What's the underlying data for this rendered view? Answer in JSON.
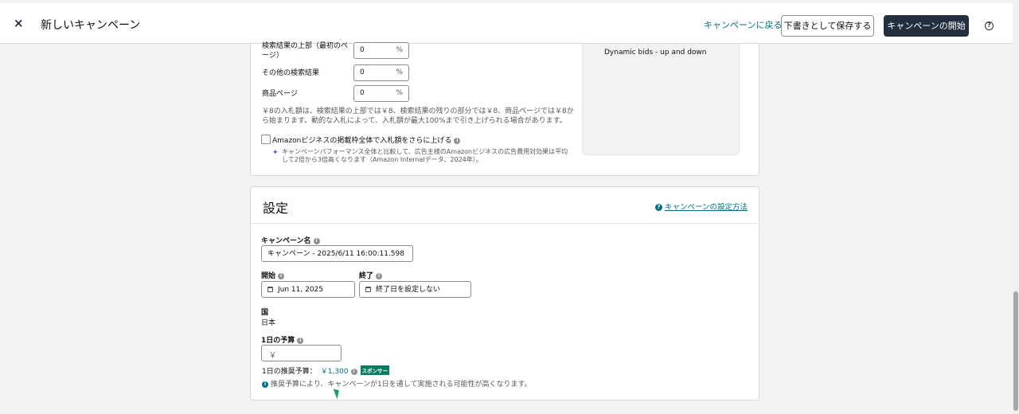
{
  "header": {
    "close_glyph": "×",
    "title": "新しいキャンペーン",
    "back_link": "キャンペーンに戻る",
    "save_draft": "下書きとして保存する",
    "launch": "キャンペーンの開始",
    "help_glyph": "?"
  },
  "bids": {
    "rows": [
      {
        "label": "検索結果の上部（最初のページ）",
        "value": "0",
        "unit": "%"
      },
      {
        "label": "その他の検索結果",
        "value": "0",
        "unit": "%"
      },
      {
        "label": "商品ページ",
        "value": "0",
        "unit": "%"
      }
    ],
    "description": "￥8の入札額は、検索結果の上部では￥8、検索結果の残りの部分では￥8、商品ページでは￥8から始まります。動的な入札によって、入札額が最大100%まで引き上げられる場合があります。",
    "business_checkbox_label": "Amazonビジネスの掲載枠全体で入札額をさらに上げる",
    "business_note": "キャンペーンパフォーマンス全体と比較して、広告主様のAmazonビジネスの広告費用対効果は平均して2倍から3倍高くなります（Amazon Internalデータ、2024年）。",
    "side_panel_text": "Dynamic bids - up and down"
  },
  "settings": {
    "title": "設定",
    "howto_link": "キャンペーンの設定方法",
    "campaign_name_label": "キャンペーン名",
    "campaign_name_value": "キャンペーン - 2025/6/11 16:00:11.598",
    "start_label": "開始",
    "start_value": "Jun 11, 2025",
    "end_label": "終了",
    "end_value": "終了日を設定しない",
    "country_label": "国",
    "country_value": "日本",
    "budget_label": "1日の予算",
    "budget_prefix": "￥",
    "recommended_label": "1日の推奨予算：",
    "recommended_value": "￥1,300",
    "sponsor_badge": "スポンサー",
    "recommended_note": "推奨予算により、キャンペーンが1日を通して実施される可能性が高くなります。"
  },
  "colors": {
    "accent": "#007185",
    "dark_button": "#232f3e",
    "badge": "#067d62"
  }
}
